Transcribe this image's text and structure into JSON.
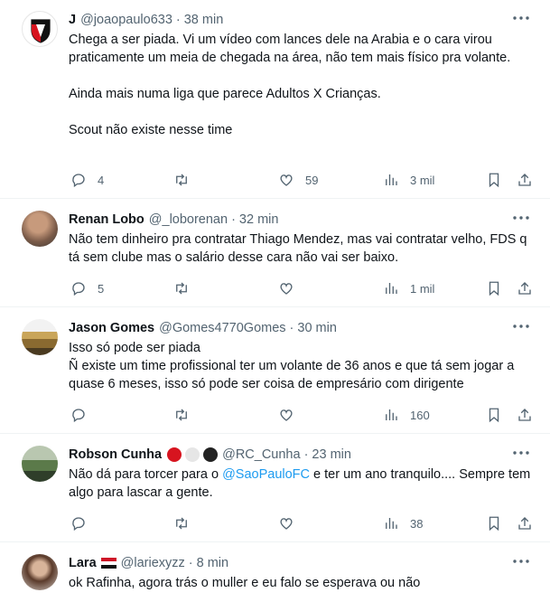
{
  "tweets": [
    {
      "name": "J",
      "handle": "@joaopaulo633",
      "separator": "·",
      "time": "38 min",
      "avatar": "sao-paulo-fc-crest-icon",
      "lines": [
        "Chega a ser piada. Vi um vídeo com lances dele na Arabia e o cara virou praticamente um meia de chegada na área, não tem mais físico pra volante.",
        "",
        "Ainda mais numa liga que parece Adultos X Crianças.",
        "",
        "Scout não existe nesse time"
      ],
      "replies": "4",
      "retweets": "",
      "likes": "59",
      "views": "3 mil"
    },
    {
      "name": "Renan Lobo",
      "handle": "@_loborenan",
      "separator": "·",
      "time": "32 min",
      "avatar": "user-photo",
      "lines": [
        "Não tem dinheiro pra contratar Thiago Mendez, mas vai contratar velho, FDS q tá sem clube mas o salário desse cara não vai ser baixo."
      ],
      "replies": "5",
      "retweets": "",
      "likes": "",
      "views": "1 mil"
    },
    {
      "name": "Jason Gomes",
      "handle": "@Gomes4770Gomes",
      "separator": "·",
      "time": "30 min",
      "avatar": "user-photo",
      "lines": [
        "Isso só pode ser piada",
        "Ñ existe um time profissional ter um volante de 36 anos e que tá sem jogar a quase 6 meses, isso só pode ser coisa de empresário com dirigente"
      ],
      "replies": "",
      "retweets": "",
      "likes": "",
      "views": "160"
    },
    {
      "name": "Robson Cunha",
      "handle": "@RC_Cunha",
      "separator": "·",
      "time": "23 min",
      "avatar": "user-photo",
      "text_before_mention": "Não dá para torcer para o ",
      "mention": "@SaoPauloFC",
      "text_after_mention": " e ter um ano tranquilo.... Sempre tem algo para lascar a gente.",
      "replies": "",
      "retweets": "",
      "likes": "",
      "views": "38"
    },
    {
      "name": "Lara",
      "handle": "@lariexyzz",
      "separator": "·",
      "time": "8 min",
      "avatar": "user-photo",
      "lines": [
        "ok Rafinha, agora trás o muller e eu falo se esperava ou não"
      ]
    }
  ],
  "colors": {
    "text": "#0f1419",
    "secondary": "#536471",
    "link": "#1d9bf0",
    "divider": "#eff3f4",
    "badge_red": "#d7141f",
    "badge_white": "#e6e6e6",
    "badge_black": "#222222"
  }
}
